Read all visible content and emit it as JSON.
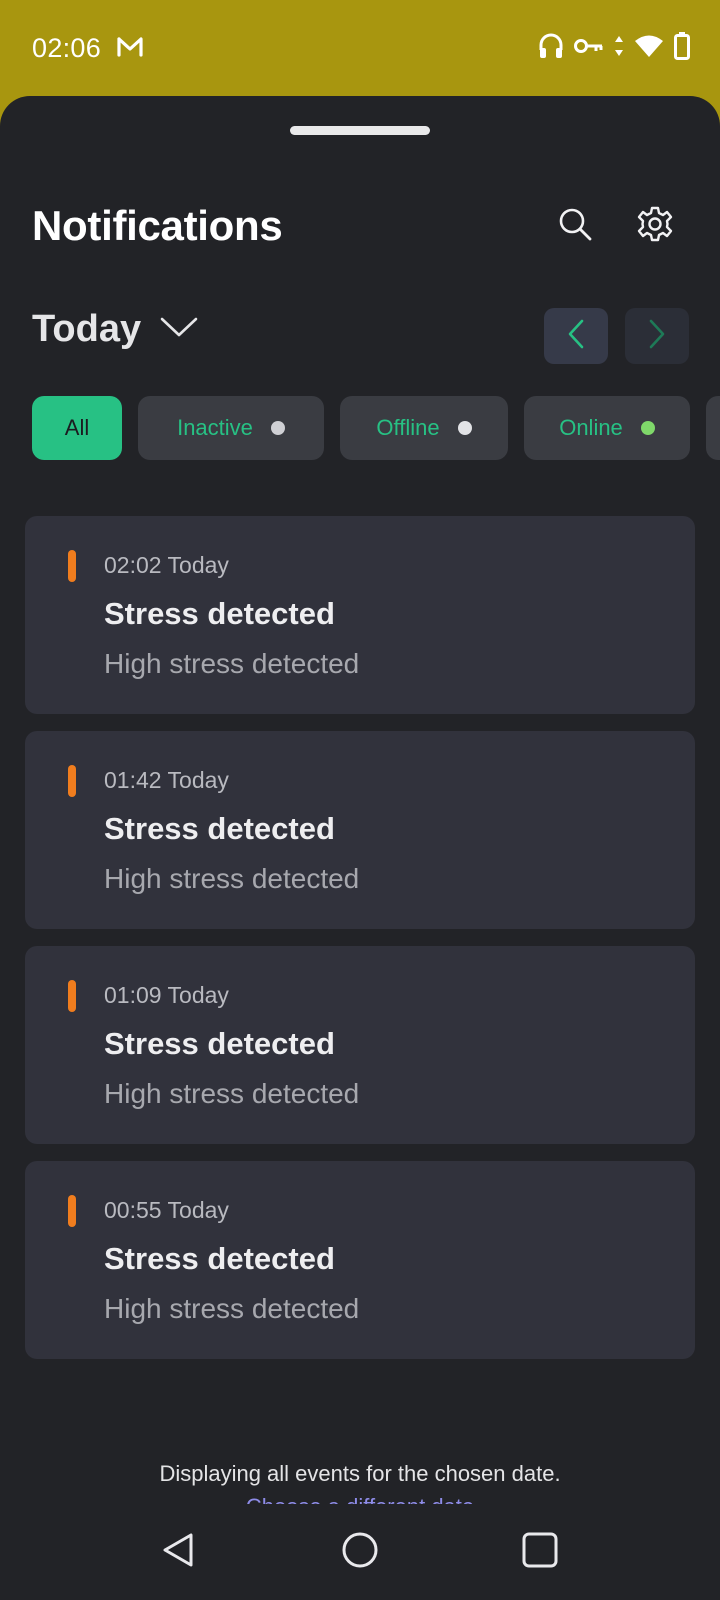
{
  "status_bar": {
    "time": "02:06",
    "mail_icon": "gmail-icon",
    "icons": [
      "headphones-icon",
      "vpn-key-icon",
      "data-arrows-icon",
      "wifi-icon",
      "battery-icon"
    ]
  },
  "header": {
    "title": "Notifications",
    "search_icon": "search-icon",
    "settings_icon": "gear-icon"
  },
  "date_selector": {
    "label": "Today",
    "icon": "chevron-down-icon",
    "prev_icon": "chevron-left-icon",
    "next_icon": "chevron-right-icon"
  },
  "filters": [
    {
      "label": "All",
      "selected": true
    },
    {
      "label": "Inactive",
      "dot_color": "#cfd0d4"
    },
    {
      "label": "Offline",
      "dot_color": "#e2e3e6"
    },
    {
      "label": "Online",
      "dot_color": "#7fd86a"
    }
  ],
  "notifications": [
    {
      "time": "02:02 Today",
      "title": "Stress detected",
      "body": "High stress detected"
    },
    {
      "time": "01:42 Today",
      "title": "Stress detected",
      "body": "High stress detected"
    },
    {
      "time": "01:09 Today",
      "title": "Stress detected",
      "body": "High stress detected"
    },
    {
      "time": "00:55 Today",
      "title": "Stress detected",
      "body": "High stress detected"
    }
  ],
  "footer": {
    "text": "Displaying all events for the chosen date.",
    "link": "Choose a different date"
  },
  "colors": {
    "accent": "#27c184",
    "severity": "#f07d1e",
    "background": "#222327",
    "card": "#31323c",
    "status_bar": "#a8960f"
  },
  "system_nav": [
    "back-triangle-icon",
    "home-circle-icon",
    "recents-square-icon"
  ]
}
